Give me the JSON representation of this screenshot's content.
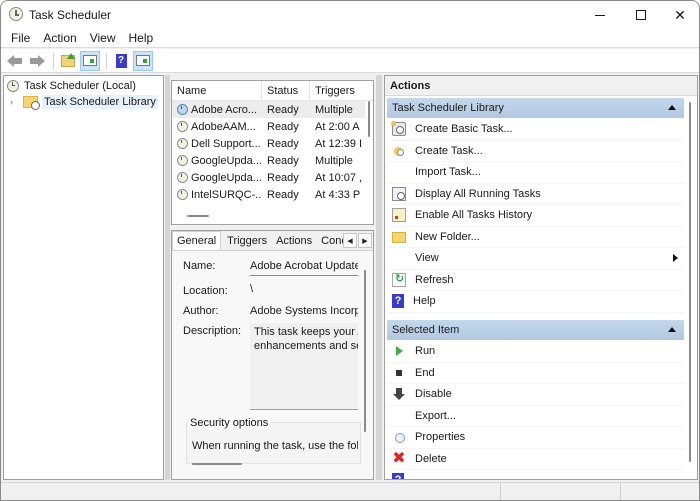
{
  "window": {
    "title": "Task Scheduler",
    "controls": {
      "minimize": "minimize",
      "maximize": "maximize",
      "close": "✕"
    }
  },
  "menu": [
    "File",
    "Action",
    "View",
    "Help"
  ],
  "toolbar": {
    "buttons": [
      "back-arrow-icon",
      "forward-arrow-icon",
      "up-folder-icon",
      "show-hide-console-tree-icon",
      "help-icon",
      "show-hide-action-pane-icon"
    ],
    "help_glyph": "?"
  },
  "tree": {
    "root": "Task Scheduler (Local)",
    "child": "Task Scheduler Library",
    "chevron": "›"
  },
  "task_list": {
    "columns": [
      "Name",
      "Status",
      "Triggers"
    ],
    "rows": [
      {
        "name": "Adobe Acro...",
        "status": "Ready",
        "triggers": "Multiple"
      },
      {
        "name": "AdobeAAM...",
        "status": "Ready",
        "triggers": "At 2:00 A"
      },
      {
        "name": "Dell Support...",
        "status": "Ready",
        "triggers": "At 12:39 I"
      },
      {
        "name": "GoogleUpda...",
        "status": "Ready",
        "triggers": "Multiple"
      },
      {
        "name": "GoogleUpda...",
        "status": "Ready",
        "triggers": "At 10:07 ,"
      },
      {
        "name": "IntelSURQC-...",
        "status": "Ready",
        "triggers": "At 4:33 P"
      }
    ],
    "selected_index": 0
  },
  "detail": {
    "tabs": [
      "General",
      "Triggers",
      "Actions",
      "Conc"
    ],
    "active_tab": "General",
    "scroll_left": "◀",
    "scroll_right": "▶",
    "fields": {
      "name_label": "Name:",
      "name_value": "Adobe Acrobat Update",
      "location_label": "Location:",
      "location_value": "\\",
      "author_label": "Author:",
      "author_value": "Adobe Systems Incorp",
      "description_label": "Description:",
      "description_line1": "This task keeps your A",
      "description_line2": "enhancements and se"
    },
    "security": {
      "title": "Security options",
      "text": "When running the task, use the foll"
    }
  },
  "actions": {
    "title": "Actions",
    "sections": [
      {
        "header": "Task Scheduler Library",
        "items": [
          {
            "label": "Create Basic Task...",
            "icon": "create-basic-task-icon"
          },
          {
            "label": "Create Task...",
            "icon": "create-task-icon"
          },
          {
            "label": "Import Task...",
            "icon": ""
          },
          {
            "label": "Display All Running Tasks",
            "icon": "display-running-tasks-icon"
          },
          {
            "label": "Enable All Tasks History",
            "icon": "tasks-history-icon"
          },
          {
            "label": "New Folder...",
            "icon": "new-folder-icon"
          },
          {
            "label": "View",
            "icon": "",
            "submenu": true
          },
          {
            "label": "Refresh",
            "icon": "refresh-icon"
          },
          {
            "label": "Help",
            "icon": "help-icon"
          }
        ]
      },
      {
        "header": "Selected Item",
        "items": [
          {
            "label": "Run",
            "icon": "run-icon"
          },
          {
            "label": "End",
            "icon": "end-icon"
          },
          {
            "label": "Disable",
            "icon": "disable-icon"
          },
          {
            "label": "Export...",
            "icon": ""
          },
          {
            "label": "Properties",
            "icon": "properties-icon"
          },
          {
            "label": "Delete",
            "icon": "delete-icon"
          }
        ]
      }
    ],
    "help_glyph": "?",
    "delete_glyph": "✖"
  }
}
